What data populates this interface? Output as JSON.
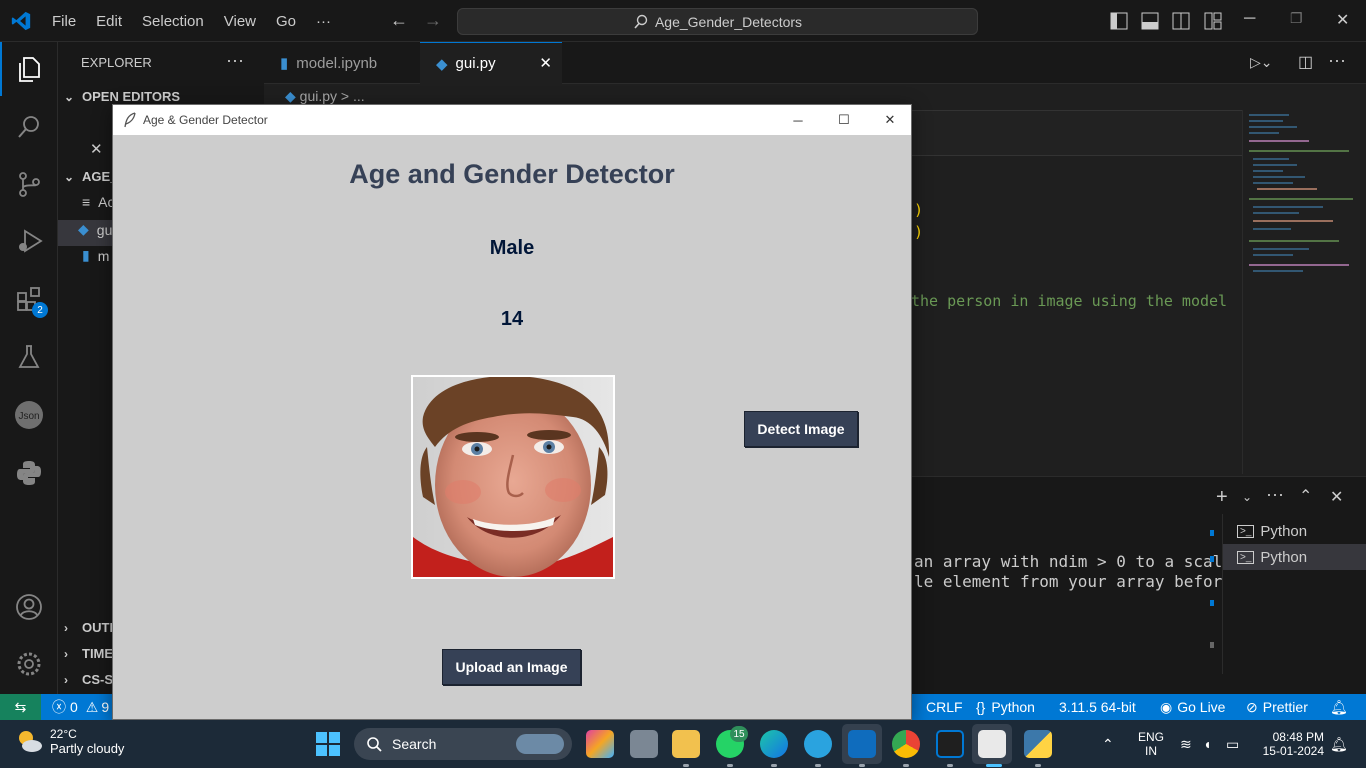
{
  "vscode": {
    "menu": [
      "File",
      "Edit",
      "Selection",
      "View",
      "Go",
      "···"
    ],
    "command_center": "Age_Gender_Detectors",
    "sidebar": {
      "title": "EXPLORER",
      "open_editors": "OPEN EDITORS",
      "folder": "AGE_",
      "files": [
        "Ac",
        "gu",
        "m"
      ],
      "outline": "OUTL",
      "timeline": "TIME",
      "cs": "CS-SC"
    },
    "activity_badge": "2",
    "tabs": [
      {
        "label": "model.ipynb"
      },
      {
        "label": "gui.py"
      }
    ],
    "breadcrumb": "gui.py > ...",
    "code_fragments": [
      ")",
      ")",
      "the person in image using the model"
    ],
    "terminal_lines": [
      "an array with ndim > 0 to a scal",
      "le element from your array befor"
    ],
    "terminal_list": [
      "Python",
      "Python"
    ],
    "status": {
      "errors": "0",
      "warnings": "9",
      "eol": "CRLF",
      "language": "Python",
      "interpreter": "3.11.5 64-bit",
      "go_live": "Go Live",
      "prettier": "Prettier"
    }
  },
  "app": {
    "window_title": "Age & Gender Detector",
    "heading": "Age and Gender Detector",
    "gender": "Male",
    "age": "14",
    "detect_button": "Detect Image",
    "upload_button": "Upload an Image",
    "colors": {
      "button_bg": "#364156",
      "label_fg": "#011638",
      "body_bg": "#cdcdcd"
    }
  },
  "taskbar": {
    "temperature": "22°C",
    "weather": "Partly cloudy",
    "search": "Search",
    "whatsapp_badge": "15",
    "lang1": "ENG",
    "lang2": "IN",
    "time": "08:48 PM",
    "date": "15-01-2024"
  }
}
